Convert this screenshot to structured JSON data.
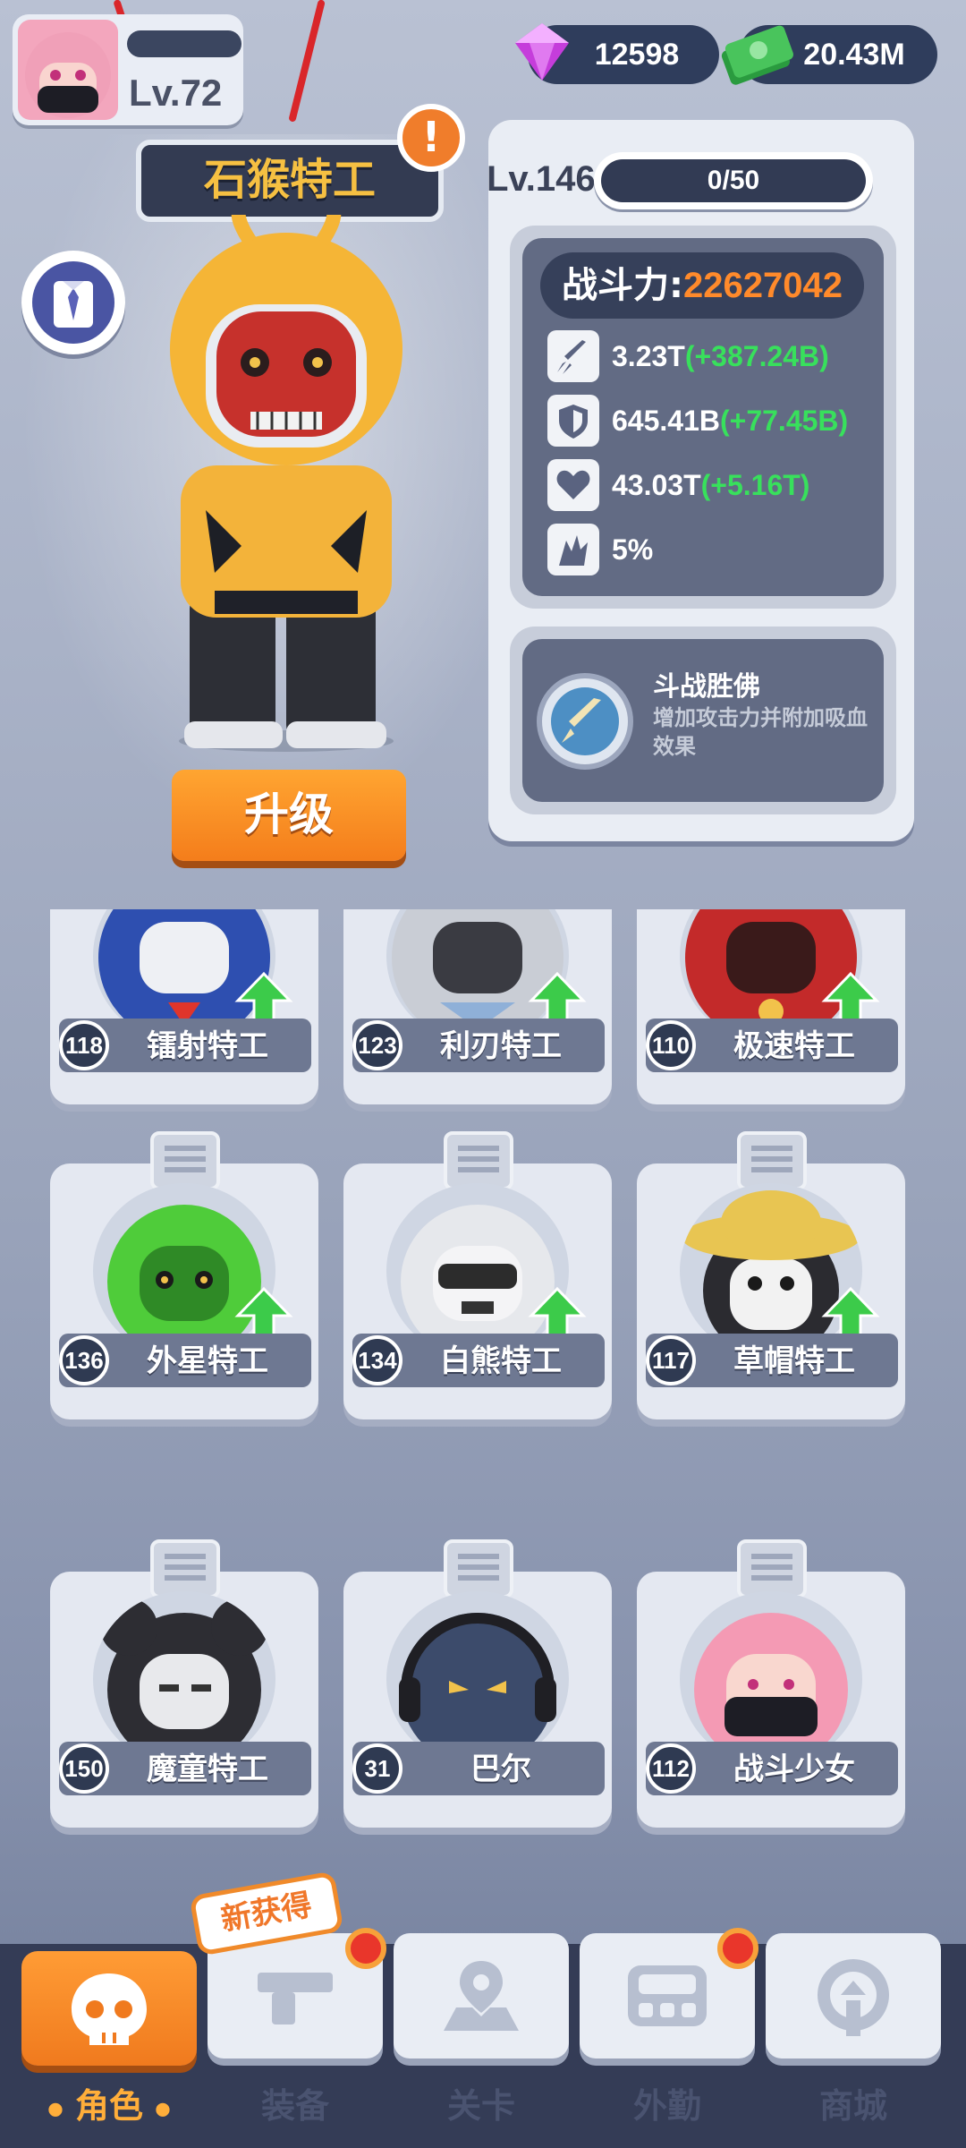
{
  "player": {
    "level": "Lv.72"
  },
  "currency": {
    "gems": "12598",
    "cash": "20.43M"
  },
  "hero": {
    "name": "石猴特工",
    "alert": "!",
    "level": "Lv.146",
    "exp": "0/50",
    "power_label": "战斗力:",
    "power_value": "22627042",
    "upgrade_label": "升级"
  },
  "stats": [
    {
      "icon": "rocket-icon",
      "value": "3.23T",
      "bonus": "(+387.24B)"
    },
    {
      "icon": "shield-icon",
      "value": "645.41B",
      "bonus": "(+77.45B)"
    },
    {
      "icon": "heart-icon",
      "value": "43.03T",
      "bonus": "(+5.16T)"
    },
    {
      "icon": "crit-icon",
      "value": "5%",
      "bonus": ""
    }
  ],
  "skill": {
    "name": "斗战胜佛",
    "description": "增加攻击力并附加吸血效果"
  },
  "roster": [
    {
      "level": "118",
      "name": "镭射特工",
      "upgrade": true,
      "color": "#2e4fb0"
    },
    {
      "level": "123",
      "name": "利刃特工",
      "upgrade": true,
      "color": "#d4d8df"
    },
    {
      "level": "110",
      "name": "极速特工",
      "upgrade": true,
      "color": "#c32a2a"
    },
    {
      "level": "136",
      "name": "外星特工",
      "upgrade": true,
      "color": "#4fcc3a"
    },
    {
      "level": "134",
      "name": "白熊特工",
      "upgrade": true,
      "color": "#e6e8ec"
    },
    {
      "level": "117",
      "name": "草帽特工",
      "upgrade": true,
      "color": "#e8c552"
    },
    {
      "level": "150",
      "name": "魔童特工",
      "upgrade": false,
      "color": "#2d2d33"
    },
    {
      "level": "31",
      "name": "巴尔",
      "upgrade": false,
      "color": "#3c4b6b"
    },
    {
      "level": "112",
      "name": "战斗少女",
      "upgrade": false,
      "color": "#f49ab4"
    }
  ],
  "nav": {
    "new_tag": "新获得",
    "tabs": [
      {
        "label": "角色",
        "icon": "skull-icon",
        "active": true
      },
      {
        "label": "装备",
        "icon": "gun-icon",
        "active": false,
        "dot": true
      },
      {
        "label": "关卡",
        "icon": "map-pin-icon",
        "active": false
      },
      {
        "label": "外勤",
        "icon": "device-icon",
        "active": false,
        "dot": true
      },
      {
        "label": "商城",
        "icon": "shop-icon",
        "active": false
      }
    ]
  },
  "colors": {
    "accent": "#f47d1b",
    "panel": "#626b84",
    "bonus": "#38e05c",
    "power": "#ff8a2b"
  }
}
